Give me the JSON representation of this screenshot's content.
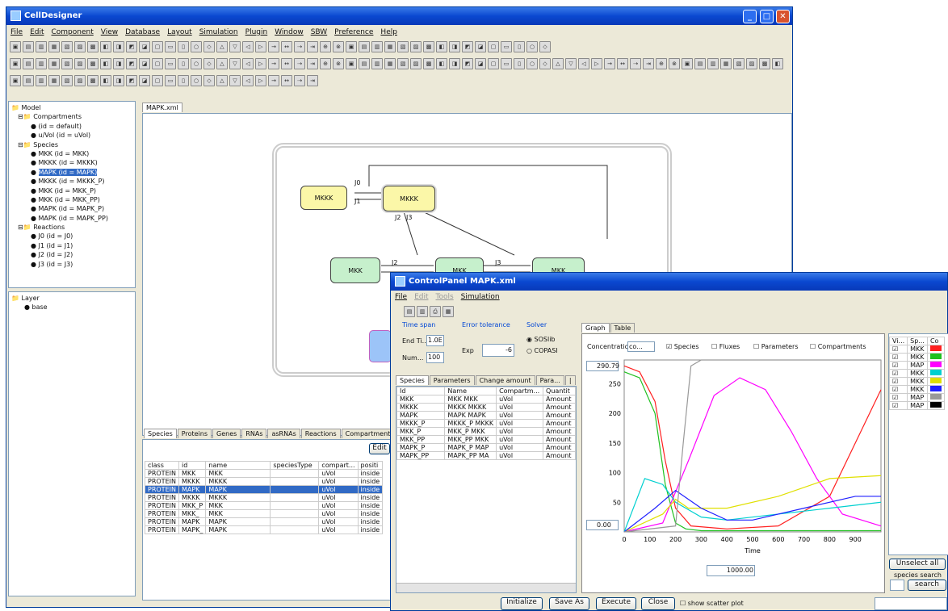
{
  "main_window": {
    "title": "CellDesigner",
    "menu": [
      "File",
      "Edit",
      "Component",
      "View",
      "Database",
      "Layout",
      "Simulation",
      "Plugin",
      "Window",
      "SBW",
      "Preference",
      "Help"
    ]
  },
  "tree": {
    "items": [
      "Model",
      "Compartments",
      "(id = default)",
      "u/Vol (id = uVol)",
      "Species",
      "MKK (id = MKK)",
      "MKKK (id = MKKK)",
      "MAPK (id = MAPK)",
      "MKKK (id = MKKK_P)",
      "MKK (id = MKK_P)",
      "MKK (id = MKK_PP)",
      "MAPK (id = MAPK_P)",
      "MAPK (id = MAPK_PP)",
      "Reactions",
      "J0 (id = J0)",
      "J1 (id = J1)",
      "J2 (id = J2)",
      "J3 (id = J3)"
    ],
    "layer_items": [
      "Layer",
      "base"
    ]
  },
  "canvas": {
    "tab": "MAPK.xml",
    "nodes": {
      "mkkk1": "MKKK",
      "mkkk2": "MKKK",
      "mkk1": "MKK",
      "mkk2": "MKK",
      "mkk3": "MKK"
    },
    "reaction_labels": {
      "j0": "J0",
      "j1": "J1",
      "j2": "J2",
      "j3": "J3",
      "j2b": "J2",
      "j3b": "J3"
    }
  },
  "bottom_panel": {
    "tabs": [
      "Species",
      "Proteins",
      "Genes",
      "RNAs",
      "asRNAs",
      "Reactions",
      "Compartment"
    ],
    "edit_label": "Edit",
    "headers": [
      "class",
      "id",
      "name",
      "speciesType",
      "compart...",
      "positi"
    ],
    "rows": [
      [
        "PROTEIN",
        "MKK",
        "MKK",
        "",
        "uVol",
        "inside"
      ],
      [
        "PROTEIN",
        "MKKK",
        "MKKK",
        "",
        "uVol",
        "inside"
      ],
      [
        "PROTEIN",
        "MAPK",
        "MAPK",
        "",
        "uVol",
        "inside"
      ],
      [
        "PROTEIN",
        "MKKK",
        "MKKK",
        "",
        "uVol",
        "inside"
      ],
      [
        "PROTEIN",
        "MKK_P",
        "MKK",
        "",
        "uVol",
        "inside"
      ],
      [
        "PROTEIN",
        "MKK_",
        "MKK",
        "",
        "uVol",
        "inside"
      ],
      [
        "PROTEIN",
        "MAPK",
        "MAPK",
        "",
        "uVol",
        "inside"
      ],
      [
        "PROTEIN",
        "MAPK_",
        "MAPK",
        "",
        "uVol",
        "inside"
      ]
    ]
  },
  "control_panel": {
    "title": "ControlPanel MAPK.xml",
    "menu": [
      "File",
      "Edit",
      "Tools",
      "Simulation"
    ],
    "time_span": {
      "label": "Time span",
      "end_label": "End Ti...",
      "end_value": "1.0E",
      "num_label": "Num...",
      "num_value": "100"
    },
    "error": {
      "label": "Error tolerance",
      "exp_label": "Exp",
      "exp_value": "-6"
    },
    "solver": {
      "label": "Solver",
      "opt1": "SOSlib",
      "opt2": "COPASI"
    },
    "left_tabs": [
      "Species",
      "Parameters",
      "Change amount",
      "Para...",
      "|"
    ],
    "species_headers": [
      "Id",
      "Name",
      "Compartm...",
      "Quantit"
    ],
    "species_rows": [
      [
        "MKK",
        "MKK MKK",
        "uVol",
        "Amount"
      ],
      [
        "MKKK",
        "MKKK MKKK",
        "uVol",
        "Amount"
      ],
      [
        "MAPK",
        "MAPK MAPK",
        "uVol",
        "Amount"
      ],
      [
        "MKKK_P",
        "MKKK_P MKKK",
        "uVol",
        "Amount"
      ],
      [
        "MKK_P",
        "MKK_P MKK",
        "uVol",
        "Amount"
      ],
      [
        "MKK_PP",
        "MKK_PP MKK",
        "uVol",
        "Amount"
      ],
      [
        "MAPK_P",
        "MAPK_P MAP",
        "uVol",
        "Amount"
      ],
      [
        "MAPK_PP",
        "MAPK_PP MA",
        "uVol",
        "Amount"
      ]
    ],
    "graph_tabs": [
      "Graph",
      "Table"
    ],
    "concentration_label": "Concentration",
    "conc_value": "co...",
    "check_species": "Species",
    "check_fluxes": "Fluxes",
    "check_params": "Parameters",
    "check_comps": "Compartments",
    "ymax_value": "290.79",
    "ymin_value": "0.00",
    "xmax_value": "1000.00",
    "legend_headers": [
      "Vi...",
      "Sp...",
      "Co"
    ],
    "legend_rows": [
      "MKK",
      "MKK",
      "MAP",
      "MKK",
      "MKK",
      "MKK",
      "MAP",
      "MAP"
    ],
    "unselect_label": "Unselect all",
    "species_search_label": "species search",
    "search_label": "search",
    "buttons": {
      "initialize": "Initialize",
      "save_as": "Save As",
      "execute": "Execute",
      "close": "Close",
      "show_scatter": "show scatter plot"
    }
  },
  "chart_data": {
    "type": "line",
    "xlabel": "Time",
    "ylabel": "",
    "xlim": [
      0,
      1000
    ],
    "ylim": [
      0,
      290
    ],
    "x_ticks": [
      "0",
      "100",
      "200",
      "300",
      "400",
      "500",
      "600",
      "700",
      "800",
      "900"
    ],
    "y_ticks": [
      "50",
      "100",
      "150",
      "200",
      "250"
    ],
    "series": [
      {
        "color": "#ff2020",
        "x": [
          0,
          60,
          120,
          160,
          200,
          260,
          400,
          600,
          800,
          900,
          1000
        ],
        "y": [
          280,
          270,
          220,
          120,
          40,
          10,
          5,
          10,
          60,
          150,
          240
        ]
      },
      {
        "color": "#20c020",
        "x": [
          0,
          60,
          120,
          160,
          200,
          240,
          300,
          600,
          1000
        ],
        "y": [
          270,
          260,
          200,
          80,
          15,
          5,
          2,
          2,
          2
        ]
      },
      {
        "color": "#ff00ff",
        "x": [
          0,
          150,
          250,
          350,
          450,
          550,
          650,
          750,
          850,
          1000
        ],
        "y": [
          0,
          15,
          120,
          230,
          260,
          240,
          170,
          90,
          30,
          10
        ]
      },
      {
        "color": "#00d0d0",
        "x": [
          0,
          80,
          150,
          200,
          300,
          400,
          600,
          800,
          1000
        ],
        "y": [
          0,
          90,
          80,
          50,
          25,
          20,
          30,
          40,
          50
        ]
      },
      {
        "color": "#e0e000",
        "x": [
          0,
          150,
          200,
          250,
          400,
          600,
          800,
          1000
        ],
        "y": [
          0,
          30,
          55,
          40,
          40,
          60,
          90,
          95
        ]
      },
      {
        "color": "#2020ff",
        "x": [
          0,
          120,
          200,
          300,
          400,
          500,
          700,
          900,
          1000
        ],
        "y": [
          0,
          40,
          70,
          40,
          20,
          20,
          40,
          60,
          60
        ]
      },
      {
        "color": "#999999",
        "x": [
          0,
          200,
          230,
          260,
          300,
          1000
        ],
        "y": [
          0,
          10,
          150,
          280,
          290,
          290
        ]
      }
    ]
  }
}
